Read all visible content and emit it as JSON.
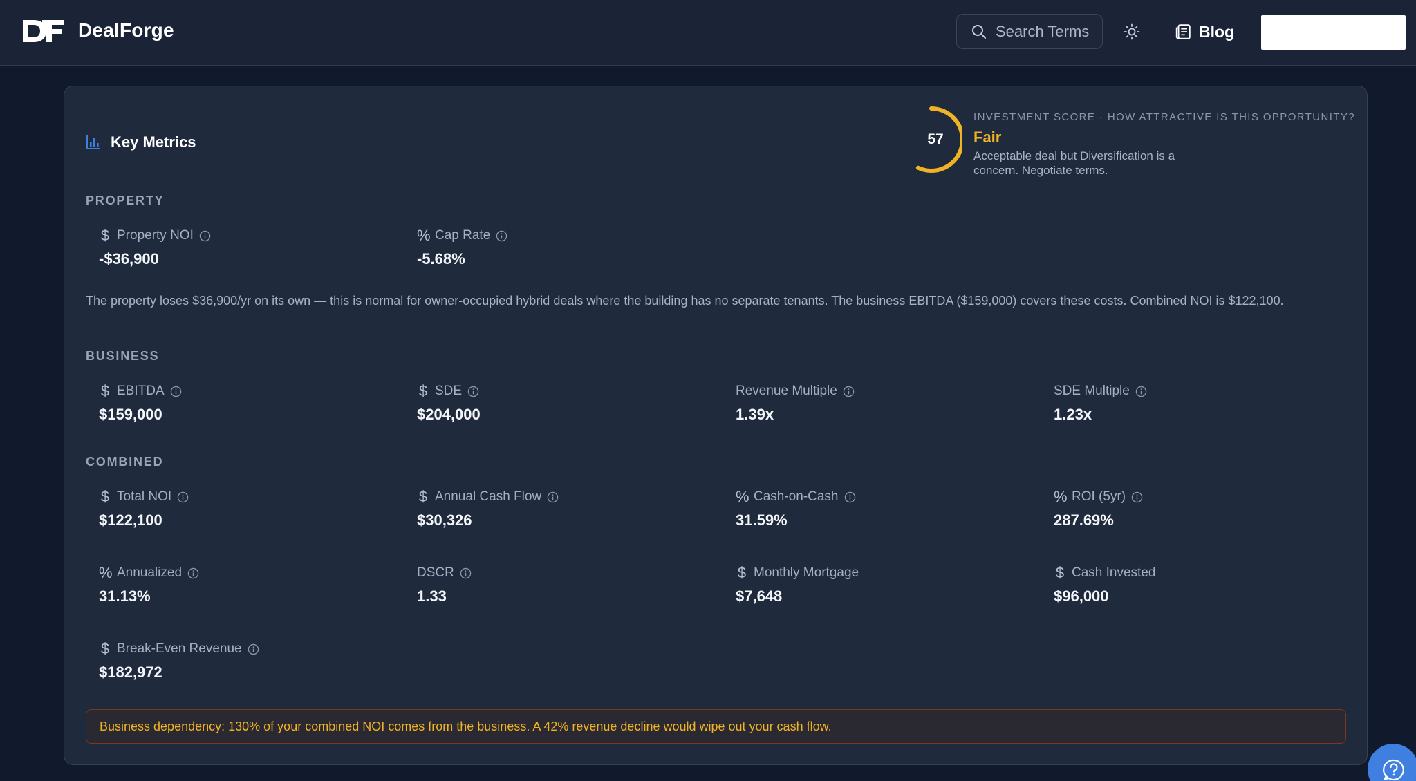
{
  "nav": {
    "brand": "DealForge",
    "logo_text": "DF",
    "search_placeholder": "Search Terms",
    "blog_label": "Blog"
  },
  "card": {
    "title": "Key Metrics",
    "score": {
      "value": "57",
      "fraction": 0.57,
      "caption": "INVESTMENT SCORE · HOW ATTRACTIVE IS THIS OPPORTUNITY?",
      "grade": "Fair",
      "description": "Acceptable deal but Diversification is a concern. Negotiate terms.",
      "color": "#f0b323"
    },
    "sections": {
      "property": "PROPERTY",
      "business": "BUSINESS",
      "combined": "COMBINED"
    },
    "property": {
      "noi": {
        "label": "Property NOI",
        "value": "-$36,900",
        "icon": "dollar-icon"
      },
      "cap_rate": {
        "label": "Cap Rate",
        "value": "-5.68%",
        "icon": "percent-icon"
      }
    },
    "explanation": "The property loses $36,900/yr on its own — this is normal for owner-occupied hybrid deals where the building has no separate tenants. The business EBITDA ($159,000) covers these costs. Combined NOI is $122,100.",
    "business": {
      "ebitda": {
        "label": "EBITDA",
        "value": "$159,000"
      },
      "sde": {
        "label": "SDE",
        "value": "$204,000"
      },
      "revenue_multiple": {
        "label": "Revenue Multiple",
        "value": "1.39x"
      },
      "sde_multiple": {
        "label": "SDE Multiple",
        "value": "1.23x"
      }
    },
    "combined": {
      "total_noi": {
        "label": "Total NOI",
        "value": "$122,100"
      },
      "annual_cash_flow": {
        "label": "Annual Cash Flow",
        "value": "$30,326"
      },
      "cash_on_cash": {
        "label": "Cash-on-Cash",
        "value": "31.59%"
      },
      "roi_5yr": {
        "label": "ROI (5yr)",
        "value": "287.69%"
      },
      "annualized": {
        "label": "Annualized",
        "value": "31.13%"
      },
      "dscr": {
        "label": "DSCR",
        "value": "1.33"
      },
      "monthly_mortgage": {
        "label": "Monthly Mortgage",
        "value": "$7,648"
      },
      "cash_invested": {
        "label": "Cash Invested",
        "value": "$96,000"
      },
      "break_even_revenue": {
        "label": "Break-Even Revenue",
        "value": "$182,972"
      }
    },
    "warning": "Business dependency: 130% of your combined NOI comes from the business. A 42% revenue decline would wipe out your cash flow."
  },
  "colors": {
    "accent": "#3e7fe0",
    "warning": "#f0b323",
    "background": "#111a2c",
    "card": "#1f2a3d"
  }
}
